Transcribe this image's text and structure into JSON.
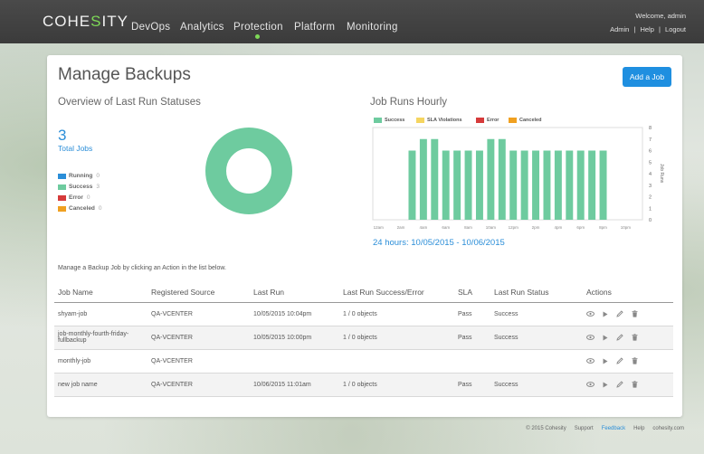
{
  "app": {
    "logo_prefix": "COHE",
    "logo_s": "S",
    "logo_suffix": "ITY"
  },
  "nav": {
    "items": [
      "DevOps",
      "Analytics",
      "Protection",
      "Platform",
      "Monitoring"
    ],
    "active": "Protection",
    "welcome": "Welcome, admin",
    "user_links": [
      "Admin",
      "Help",
      "Logout"
    ]
  },
  "page": {
    "title": "Manage Backups",
    "add_button": "Add a Job",
    "overview_title": "Overview of Last Run Statuses",
    "total_count": "3",
    "total_label": "Total Jobs",
    "status_legend": [
      {
        "label": "Running",
        "count": "0",
        "color": "#2b8ed8"
      },
      {
        "label": "Success",
        "count": "3",
        "color": "#6ecb9f"
      },
      {
        "label": "Error",
        "count": "0",
        "color": "#d63a3a"
      },
      {
        "label": "Canceled",
        "count": "0",
        "color": "#f0a020"
      }
    ],
    "hourly_title": "Job Runs Hourly",
    "range_label": "24 hours: 10/05/2015 - 10/06/2015",
    "hint": "Manage a Backup Job by clicking an Action in the list below."
  },
  "chart_data": [
    {
      "type": "pie",
      "labels": [
        "Running",
        "Success",
        "Error",
        "Canceled"
      ],
      "values": [
        0,
        3,
        0,
        0
      ],
      "colors": [
        "#2b8ed8",
        "#6ecb9f",
        "#d63a3a",
        "#f0a020"
      ]
    },
    {
      "type": "bar",
      "title": "Job Runs Hourly",
      "categories": [
        "12am",
        "1am",
        "2am",
        "3am",
        "4am",
        "5am",
        "6am",
        "7am",
        "8am",
        "9am",
        "10am",
        "11am",
        "12pm",
        "1pm",
        "2pm",
        "3pm",
        "4pm",
        "5pm",
        "6pm",
        "7pm",
        "8pm",
        "9pm",
        "10pm",
        "11pm"
      ],
      "tick_labels": [
        "12am",
        "2am",
        "4am",
        "6am",
        "8am",
        "10am",
        "12pm",
        "2pm",
        "4pm",
        "6pm",
        "8pm",
        "10pm"
      ],
      "series": [
        {
          "name": "Success",
          "color": "#6ecb9f",
          "values": [
            0,
            0,
            0,
            6,
            7,
            7,
            6,
            6,
            6,
            6,
            7,
            7,
            6,
            6,
            6,
            6,
            6,
            6,
            6,
            6,
            6,
            0,
            0,
            0
          ]
        },
        {
          "name": "SLA Violations",
          "color": "#f5d560",
          "values": [
            0,
            0,
            0,
            0,
            0,
            0,
            0,
            0,
            0,
            0,
            0,
            0,
            0,
            0,
            0,
            0,
            0,
            0,
            0,
            0,
            0,
            0,
            0,
            0
          ]
        },
        {
          "name": "Error",
          "color": "#d63a3a",
          "values": [
            0,
            0,
            0,
            0,
            0,
            0,
            0,
            0,
            0,
            0,
            0,
            0,
            0,
            0,
            0,
            0,
            0,
            0,
            0,
            0,
            0,
            0,
            0,
            0
          ]
        },
        {
          "name": "Canceled",
          "color": "#f0a020",
          "values": [
            0,
            0,
            0,
            0,
            0,
            0,
            0,
            0,
            0,
            0,
            0,
            0,
            0,
            0,
            0,
            0,
            0,
            0,
            0,
            0,
            0,
            0,
            0,
            0
          ]
        }
      ],
      "ylabel": "Job Runs",
      "ylim": [
        0,
        8
      ],
      "yticks": [
        0,
        1,
        2,
        3,
        4,
        5,
        6,
        7,
        8
      ],
      "y_axis_side": "right",
      "grid": false
    }
  ],
  "table": {
    "columns": [
      "Job Name",
      "Registered Source",
      "Last Run",
      "Last Run Success/Error",
      "SLA",
      "Last Run Status",
      "Actions"
    ],
    "rows": [
      {
        "name": "shyam-job",
        "source": "QA-VCENTER",
        "last_run": "10/05/2015 10:04pm",
        "objects": "1 / 0 objects",
        "sla": "Pass",
        "status": "Success",
        "striped": false
      },
      {
        "name": "job-monthly-fourth-friday-fullbackup",
        "source": "QA-VCENTER",
        "last_run": "10/05/2015 10:00pm",
        "objects": "1 / 0 objects",
        "sla": "Pass",
        "status": "Success",
        "striped": true
      },
      {
        "name": "monthly-job",
        "source": "QA-VCENTER",
        "last_run": "",
        "objects": "",
        "sla": "",
        "status": "",
        "striped": false
      },
      {
        "name": "new job name",
        "source": "QA-VCENTER",
        "last_run": "10/06/2015 11:01am",
        "objects": "1 / 0 objects",
        "sla": "Pass",
        "status": "Success",
        "striped": true
      }
    ],
    "action_icons": [
      "eye-icon",
      "play-icon",
      "edit-icon",
      "trash-icon"
    ]
  },
  "footer": {
    "copyright": "© 2015 Cohesity",
    "links": [
      "Support",
      "Feedback",
      "Help",
      "cohesity.com"
    ]
  }
}
